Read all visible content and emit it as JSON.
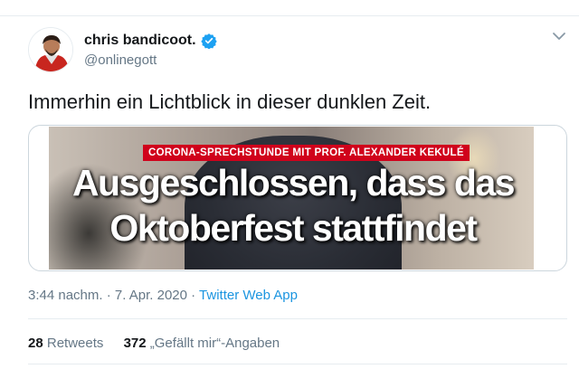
{
  "author": {
    "display_name": "chris bandicoot.",
    "handle": "@onlinegott",
    "verified": true
  },
  "tweet": {
    "text": "Immerhin ein Lichtblick in dieser dunklen Zeit."
  },
  "media": {
    "kicker": "CORONA-SPRECHSTUNDE MIT PROF. ALEXANDER KEKULÉ",
    "headline_line1": "Ausgeschlossen, dass das",
    "headline_line2": "Oktoberfest stattfindet"
  },
  "meta": {
    "time": "3:44 nachm.",
    "separator": " · ",
    "date": "7. Apr. 2020",
    "separator2": " · ",
    "source": "Twitter Web App"
  },
  "stats": {
    "retweets_count": "28",
    "retweets_label": "Retweets",
    "likes_count": "372",
    "likes_label": "„Gefällt mir“-Angaben"
  },
  "colors": {
    "link_blue": "#1b95e0",
    "verified_blue": "#1da1f2",
    "kicker_red": "#d0021b",
    "muted_text": "#657786"
  },
  "icons": {
    "verified": "verified-badge-icon",
    "menu": "chevron-down-icon"
  }
}
